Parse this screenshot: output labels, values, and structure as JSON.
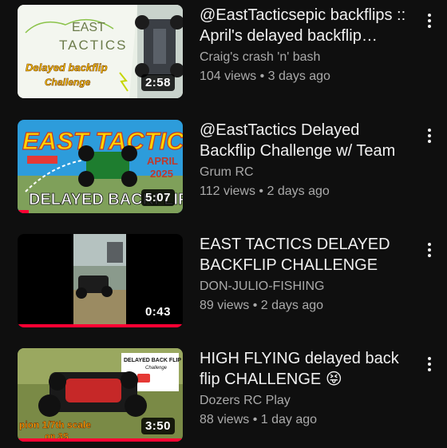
{
  "videos": [
    {
      "title": "@EastTacticsepic backflips :: April's delayed backflip challenge",
      "channel": "Craig's crash 'n' bash",
      "views": "104 views",
      "age": "3 days ago",
      "duration": "2:58",
      "thumb_text": [
        "EAST",
        "TACTICS",
        "Delayed backflip",
        "Challenge"
      ],
      "progress": 0
    },
    {
      "title": "@EastTactics Delayed Backflip Challenge w/ Team",
      "channel": "Grum RC",
      "views": "112 views",
      "age": "2 days ago",
      "duration": "5:07",
      "thumb_text": [
        "EAST TACTICS",
        "APRIL",
        "2025",
        "DELAYED BACKFLIP"
      ],
      "progress": 0.07
    },
    {
      "title": "EAST TACTICS DELAYED BACKFLIP CHALLENGE",
      "channel": "DON-JULIO-FISHING",
      "views": "89 views",
      "age": "2 days ago",
      "duration": "0:43",
      "thumb_text": [],
      "progress": 1.0
    },
    {
      "title": "HIGH FLYING delayed back flip CHALLENGE 😝",
      "channel": "Dozers RC Play",
      "views": "88 views",
      "age": "1 day ago",
      "duration": "3:50",
      "thumb_text": [
        "DELAYED BACK FLIP",
        "Challenge",
        "pion 1/7th scale",
        "on 3S"
      ],
      "progress": 1.0
    }
  ],
  "separator": "•",
  "colors": {
    "background": "#0f0f0f",
    "progress": "#ff0033",
    "secondary_text": "#aaaaaa"
  }
}
